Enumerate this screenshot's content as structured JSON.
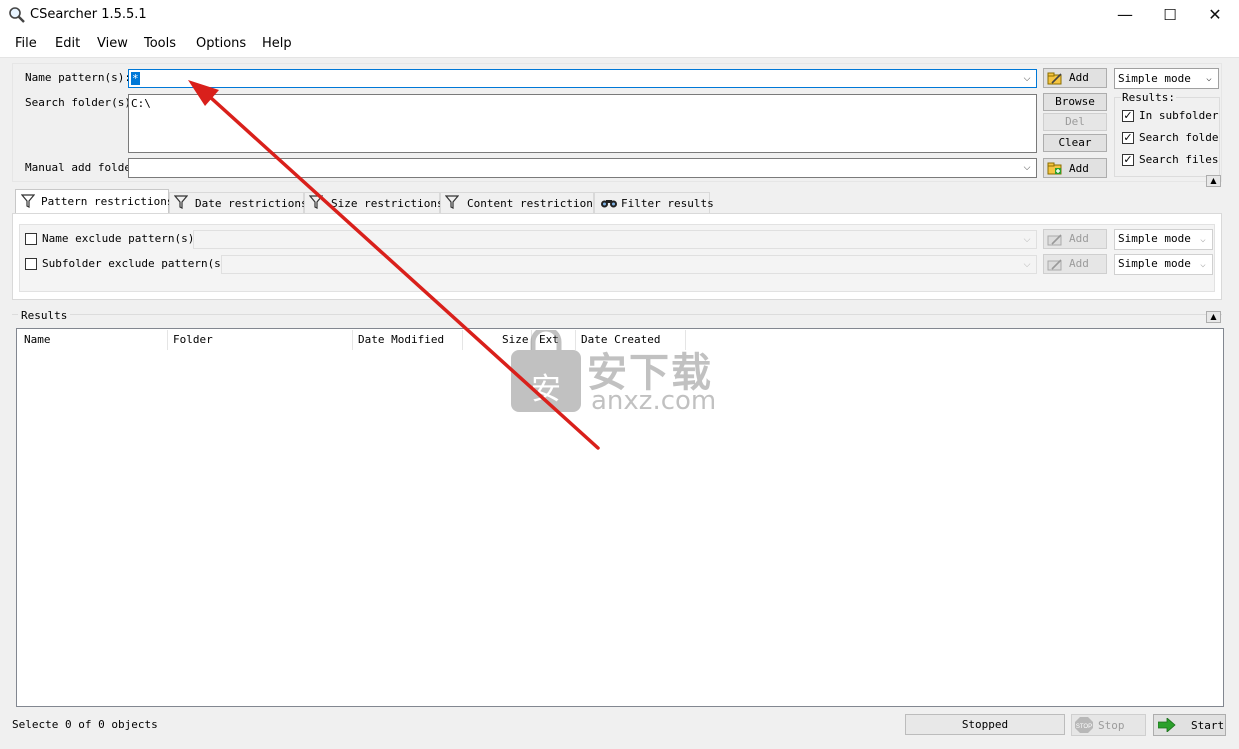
{
  "window": {
    "title": "CSearcher 1.5.5.1",
    "controls": {
      "minimize": "—",
      "maximize": "☐",
      "close": "✕"
    }
  },
  "menu": [
    "File",
    "Edit",
    "View",
    "Tools",
    "Options",
    "Help"
  ],
  "search": {
    "name_pattern_label": "Name pattern(s):",
    "name_pattern_value": "*",
    "search_folders_label": "Search folder(s):",
    "search_folders_value": "C:\\",
    "manual_add_label": "Manual add folder",
    "manual_add_value": "",
    "add_label": "Add",
    "browse_label": "Browse",
    "del_label": "Del",
    "clear_label": "Clear",
    "mode_value": "Simple mode"
  },
  "results_options": {
    "title": "Results:",
    "options": [
      {
        "label": "In subfolders",
        "checked": true
      },
      {
        "label": "Search folders",
        "checked": true
      },
      {
        "label": "Search files",
        "checked": true
      }
    ]
  },
  "tabs": [
    {
      "label": "Pattern restrictions",
      "icon": "funnel-icon",
      "active": true
    },
    {
      "label": "Date restrictions",
      "icon": "funnel-icon",
      "active": false
    },
    {
      "label": "Size restrictions",
      "icon": "funnel-icon",
      "active": false
    },
    {
      "label": "Content restrictions",
      "icon": "funnel-icon",
      "active": false
    },
    {
      "label": "Filter results",
      "icon": "binoculars-icon",
      "active": false
    }
  ],
  "pattern_restrictions": {
    "name_exclude_label": "Name exclude pattern(s):",
    "subfolder_exclude_label": "Subfolder exclude pattern(s):",
    "add_label": "Add",
    "mode_value": "Simple mode"
  },
  "results": {
    "title": "Results",
    "columns": [
      "Name",
      "Folder",
      "Date Modified",
      "Size",
      "Ext",
      "Date Created"
    ],
    "rows": []
  },
  "status": {
    "selection": "Selecte 0  of 0 objects",
    "state": "Stopped",
    "stop_label": "Stop",
    "start_label": "Start",
    "stop_icon_text": "STOP"
  },
  "watermark": {
    "brand": "安下载",
    "domain": "anxz.com",
    "shield": "安"
  },
  "colors": {
    "accent": "#0078d7",
    "arrow": "#d9201b",
    "start_green": "#2ca02c"
  }
}
